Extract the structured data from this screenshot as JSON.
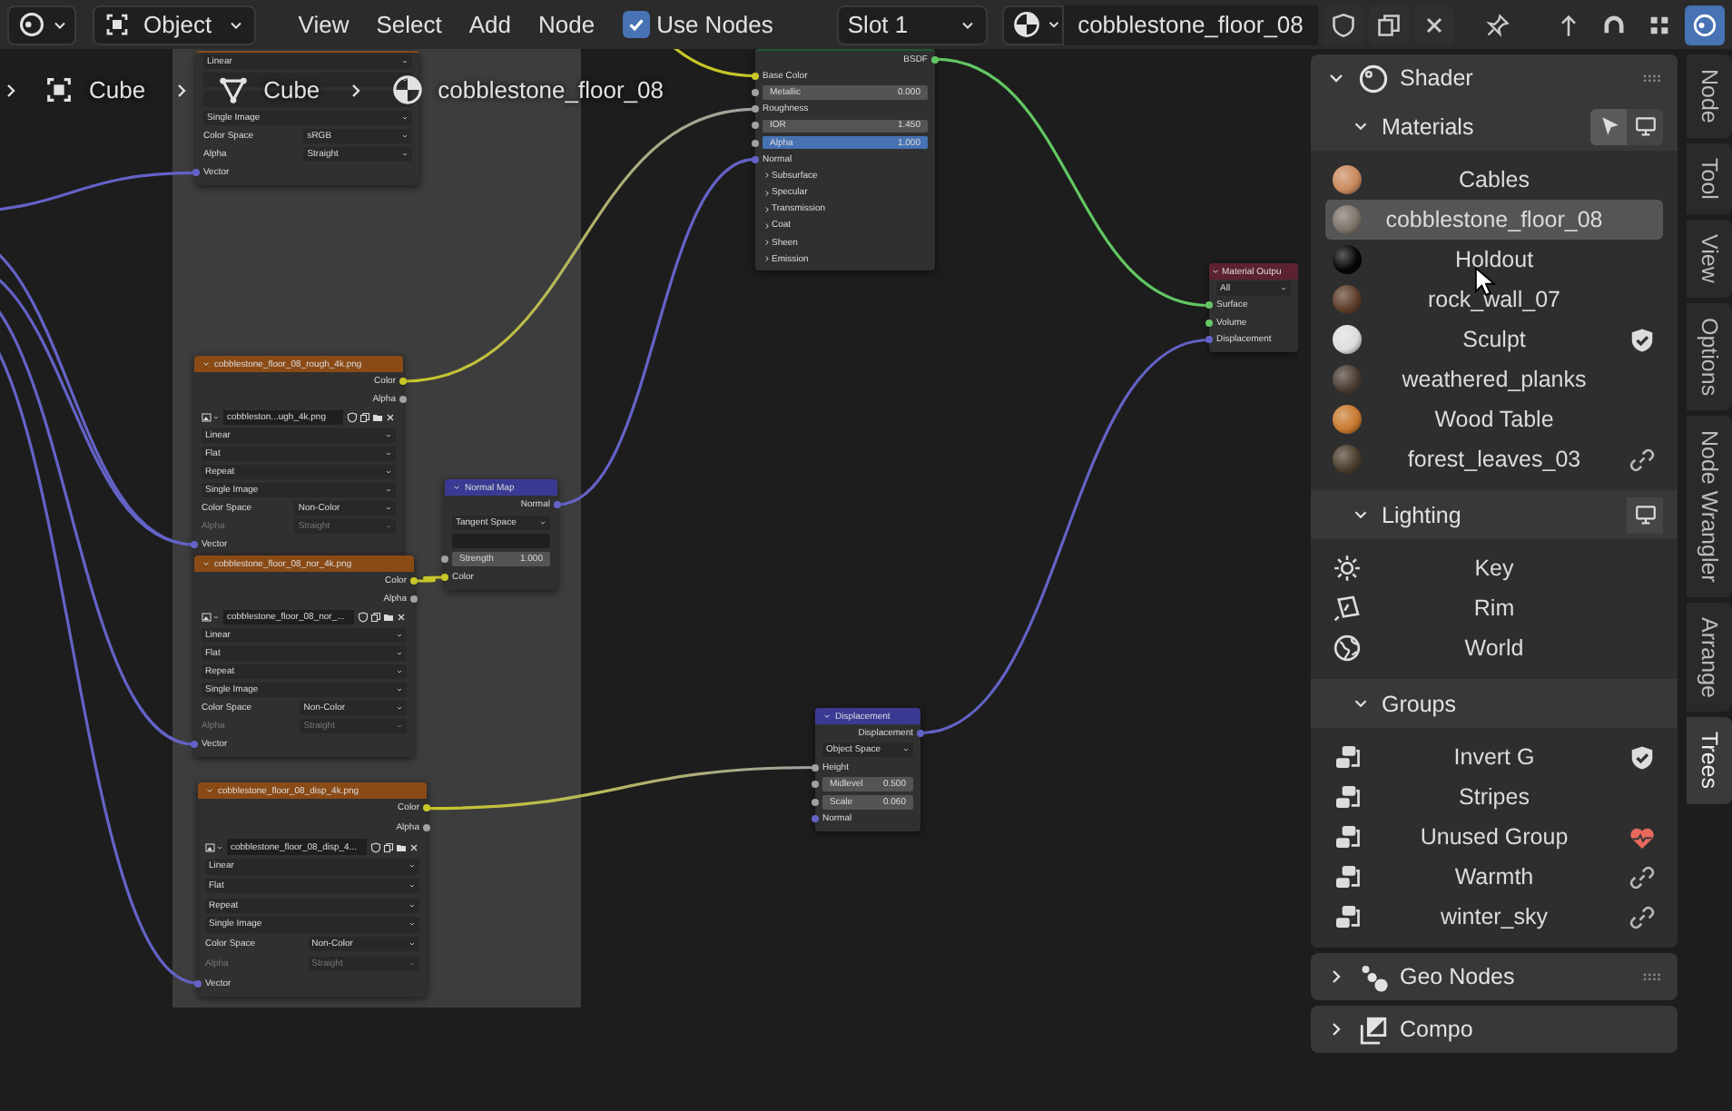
{
  "header": {
    "mode": "Object",
    "menus": [
      "View",
      "Select",
      "Add",
      "Node"
    ],
    "use_nodes": {
      "label": "Use Nodes",
      "checked": true
    },
    "slot": "Slot 1",
    "material": "cobblestone_floor_08"
  },
  "breadcrumb": [
    {
      "kind": "object",
      "label": "Cube"
    },
    {
      "kind": "mesh",
      "label": "Cube"
    },
    {
      "kind": "material",
      "label": "cobblestone_floor_08"
    }
  ],
  "nodes": [
    {
      "kind": "image",
      "rows": [
        {
          "kind": "select",
          "value": "Linear"
        },
        {
          "kind": "select"
        },
        {
          "kind": "select"
        },
        {
          "kind": "select",
          "value": "Single Image"
        },
        {
          "kind": "prop",
          "label": "Color Space",
          "value": "sRGB",
          "disabled": false
        },
        {
          "kind": "prop",
          "label": "Alpha",
          "value": "Straight",
          "disabled": false
        },
        {
          "kind": "input",
          "label": "Vector",
          "color": "#6363c7"
        }
      ]
    },
    {
      "kind": "image",
      "title": "cobblestone_floor_08_rough_4k.png",
      "rows": [
        {
          "kind": "output",
          "label": "Color",
          "color": "#c7c729"
        },
        {
          "kind": "output",
          "label": "Alpha",
          "color": "#a1a1a1"
        },
        {
          "kind": "image",
          "value": "cobbleston...ugh_4k.png"
        },
        {
          "kind": "select",
          "value": "Linear"
        },
        {
          "kind": "select",
          "value": "Flat"
        },
        {
          "kind": "select",
          "value": "Repeat"
        },
        {
          "kind": "select",
          "value": "Single Image"
        },
        {
          "kind": "prop",
          "label": "Color Space",
          "value": "Non-Color",
          "disabled": false
        },
        {
          "kind": "prop",
          "label": "Alpha",
          "value": "Straight",
          "disabled": true
        },
        {
          "kind": "input",
          "label": "Vector",
          "color": "#6363c7"
        }
      ]
    },
    {
      "kind": "image",
      "title": "cobblestone_floor_08_nor_4k.png",
      "rows": [
        {
          "kind": "output",
          "label": "Color",
          "color": "#c7c729"
        },
        {
          "kind": "output",
          "label": "Alpha",
          "color": "#a1a1a1"
        },
        {
          "kind": "image",
          "value": "cobblestone_floor_08_nor_..."
        },
        {
          "kind": "select",
          "value": "Linear"
        },
        {
          "kind": "select",
          "value": "Flat"
        },
        {
          "kind": "select",
          "value": "Repeat"
        },
        {
          "kind": "select",
          "value": "Single Image"
        },
        {
          "kind": "prop",
          "label": "Color Space",
          "value": "Non-Color",
          "disabled": false
        },
        {
          "kind": "prop",
          "label": "Alpha",
          "value": "Straight",
          "disabled": true
        },
        {
          "kind": "input",
          "label": "Vector",
          "color": "#6363c7"
        }
      ]
    },
    {
      "kind": "image",
      "title": "cobblestone_floor_08_disp_4k.png",
      "rows": [
        {
          "kind": "output",
          "label": "Color",
          "color": "#c7c729"
        },
        {
          "kind": "output",
          "label": "Alpha",
          "color": "#a1a1a1"
        },
        {
          "kind": "image",
          "value": "cobblestone_floor_08_disp_4..."
        },
        {
          "kind": "select",
          "value": "Linear"
        },
        {
          "kind": "select",
          "value": "Flat"
        },
        {
          "kind": "select",
          "value": "Repeat"
        },
        {
          "kind": "select",
          "value": "Single Image"
        },
        {
          "kind": "prop",
          "label": "Color Space",
          "value": "Non-Color",
          "disabled": false
        },
        {
          "kind": "prop",
          "label": "Alpha",
          "value": "Straight",
          "disabled": true
        },
        {
          "kind": "input",
          "label": "Vector",
          "color": "#6363c7"
        }
      ]
    },
    {
      "kind": "vector",
      "title": "Normal Map",
      "rows": [
        {
          "kind": "output",
          "label": "Normal",
          "color": "#6363c7"
        },
        {
          "kind": "select",
          "value": "Tangent Space"
        },
        {
          "kind": "field"
        },
        {
          "kind": "number",
          "label": "Strength",
          "value": "1.000",
          "color": "#a1a1a1"
        },
        {
          "kind": "input",
          "label": "Color",
          "color": "#c7c729"
        }
      ]
    },
    {
      "kind": "shader",
      "rows": [
        {
          "kind": "output",
          "label": "BSDF",
          "color": "#63c763"
        },
        {
          "kind": "input",
          "label": "Base Color",
          "color": "#c7c729"
        },
        {
          "kind": "number",
          "label": "Metallic",
          "value": "0.000",
          "color": "#a1a1a1"
        },
        {
          "kind": "input",
          "label": "Roughness",
          "color": "#a1a1a1"
        },
        {
          "kind": "number",
          "label": "IOR",
          "value": "1.450",
          "color": "#a1a1a1"
        },
        {
          "kind": "factor",
          "label": "Alpha",
          "value": "1.000",
          "level": 1,
          "color": "#a1a1a1"
        },
        {
          "kind": "input",
          "label": "Normal",
          "color": "#6363c7"
        },
        {
          "kind": "panel",
          "label": "Subsurface",
          "expanded": false
        },
        {
          "kind": "panel",
          "label": "Specular",
          "expanded": false
        },
        {
          "kind": "panel",
          "label": "Transmission",
          "expanded": false
        },
        {
          "kind": "panel",
          "label": "Coat",
          "expanded": false
        },
        {
          "kind": "panel",
          "label": "Sheen",
          "expanded": false
        },
        {
          "kind": "panel",
          "label": "Emission",
          "expanded": false
        }
      ]
    },
    {
      "kind": "output",
      "title": "Material Outpu",
      "rows": [
        {
          "kind": "select",
          "value": "All"
        },
        {
          "kind": "input",
          "label": "Surface",
          "color": "#63c763"
        },
        {
          "kind": "input",
          "label": "Volume",
          "color": "#63c763"
        },
        {
          "kind": "input",
          "label": "Displacement",
          "color": "#6363c7"
        }
      ]
    },
    {
      "kind": "vector",
      "title": "Displacement",
      "rows": [
        {
          "kind": "output",
          "label": "Displacement",
          "color": "#6363c7"
        },
        {
          "kind": "select",
          "value": "Object Space"
        },
        {
          "kind": "input",
          "label": "Height",
          "color": "#a1a1a1"
        },
        {
          "kind": "number",
          "label": "Midlevel",
          "value": "0.500",
          "color": "#a1a1a1"
        },
        {
          "kind": "number",
          "label": "Scale",
          "value": "0.060",
          "color": "#a1a1a1"
        },
        {
          "kind": "input",
          "label": "Normal",
          "color": "#6363c7"
        }
      ]
    }
  ],
  "sidebar": {
    "panels": [
      {
        "kind": "shader",
        "title": "Shader",
        "expanded": true,
        "sections": [
          {
            "kind": "materials",
            "title": "Materials",
            "expanded": true,
            "items": [
              {
                "kind": "material",
                "name": "Cables",
                "color": "#c98a5e",
                "selected": false,
                "fake_user": false,
                "linked": false,
                "orphan": false
              },
              {
                "kind": "material",
                "name": "cobblestone_floor_08",
                "color": "#7d746a",
                "selected": true,
                "fake_user": false,
                "linked": false,
                "orphan": false
              },
              {
                "kind": "material",
                "name": "Holdout",
                "color": "#060606",
                "selected": false,
                "fake_user": false,
                "linked": false,
                "orphan": false
              },
              {
                "kind": "material",
                "name": "rock_wall_07",
                "color": "#5e3e2a",
                "selected": false,
                "fake_user": false,
                "linked": false,
                "orphan": false
              },
              {
                "kind": "material",
                "name": "Sculpt",
                "color": "#dedede",
                "selected": false,
                "fake_user": true,
                "linked": false,
                "orphan": false
              },
              {
                "kind": "material",
                "name": "weathered_planks",
                "color": "#4c3e34",
                "selected": false,
                "fake_user": false,
                "linked": false,
                "orphan": false
              },
              {
                "kind": "material",
                "name": "Wood Table",
                "color": "#c87a30",
                "selected": false,
                "fake_user": false,
                "linked": false,
                "orphan": false
              },
              {
                "kind": "material",
                "name": "forest_leaves_03",
                "color": "#4c3e2e",
                "selected": false,
                "fake_user": false,
                "linked": true,
                "orphan": false
              }
            ]
          },
          {
            "kind": "lighting",
            "title": "Lighting",
            "expanded": true,
            "items": [
              {
                "kind": "sun",
                "name": "Key",
                "selected": false
              },
              {
                "kind": "area",
                "name": "Rim",
                "selected": false
              },
              {
                "kind": "world",
                "name": "World",
                "selected": false
              }
            ]
          },
          {
            "kind": "groups",
            "title": "Groups",
            "expanded": true,
            "items": [
              {
                "kind": "group",
                "name": "Invert G",
                "selected": false,
                "fake_user": true,
                "linked": false,
                "orphan": false
              },
              {
                "kind": "group",
                "name": "Stripes",
                "selected": false,
                "fake_user": false,
                "linked": false,
                "orphan": false
              },
              {
                "kind": "group",
                "name": "Unused Group",
                "selected": false,
                "fake_user": false,
                "linked": false,
                "orphan": true
              },
              {
                "kind": "group",
                "name": "Warmth",
                "selected": false,
                "fake_user": false,
                "linked": true,
                "orphan": false
              },
              {
                "kind": "group",
                "name": "winter_sky",
                "selected": false,
                "fake_user": false,
                "linked": true,
                "orphan": false
              }
            ]
          }
        ]
      },
      {
        "kind": "geometry",
        "title": "Geo Nodes",
        "expanded": false
      },
      {
        "kind": "compositing",
        "title": "Compo",
        "expanded": false
      }
    ]
  },
  "tabs": [
    {
      "label": "Node",
      "selected": false
    },
    {
      "label": "Tool",
      "selected": false
    },
    {
      "label": "View",
      "selected": false
    },
    {
      "label": "Options",
      "selected": false
    },
    {
      "label": "Node Wrangler",
      "selected": false
    },
    {
      "label": "Arrange",
      "selected": false
    },
    {
      "label": "Trees",
      "selected": true
    }
  ]
}
